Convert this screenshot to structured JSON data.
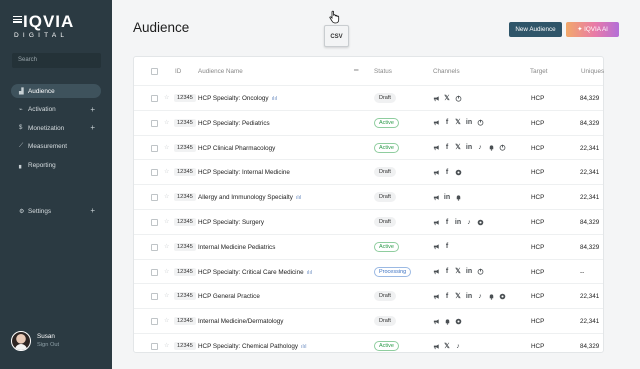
{
  "brand": {
    "name": "IQVIA",
    "sub": "DIGITAL"
  },
  "sidebar": {
    "search_placeholder": "Search",
    "items": [
      {
        "label": "Audience",
        "icon": "audience-icon",
        "active": true,
        "expandable": false
      },
      {
        "label": "Activation",
        "icon": "activation-icon",
        "active": false,
        "expandable": true
      },
      {
        "label": "Monetization",
        "icon": "dollar-icon",
        "active": false,
        "expandable": true
      },
      {
        "label": "Measurement",
        "icon": "trend-icon",
        "active": false,
        "expandable": false
      },
      {
        "label": "Reporting",
        "icon": "bar-chart-icon",
        "active": false,
        "expandable": false
      }
    ],
    "settings": {
      "label": "Settings",
      "icon": "gear-icon"
    },
    "user": {
      "name": "Susan",
      "signout": "Sign Out"
    }
  },
  "header": {
    "title": "Audience",
    "csv_label": "CSV",
    "new_audience_label": "New Audience",
    "ai_label": "IQVIA AI"
  },
  "table": {
    "columns": {
      "id": "ID",
      "name": "Audience Name",
      "status": "Status",
      "channels": "Channels",
      "target": "Target",
      "uniques": "Uniques"
    },
    "rows": [
      {
        "id": "12345",
        "name": "HCP Specialty: Oncology",
        "aud_icon": true,
        "status": "Draft",
        "channels": [
          "ads",
          "x",
          "power"
        ],
        "target": "HCP",
        "uniques": "84,329"
      },
      {
        "id": "12345",
        "name": "HCP Specialty: Pediatrics",
        "aud_icon": false,
        "status": "Active",
        "channels": [
          "ads",
          "facebook",
          "x",
          "linkedin",
          "power"
        ],
        "target": "HCP",
        "uniques": "84,329"
      },
      {
        "id": "12345",
        "name": "HCP Clinical Pharmacology",
        "aud_icon": false,
        "status": "Active",
        "channels": [
          "ads",
          "facebook",
          "x",
          "linkedin",
          "tiktok",
          "bell",
          "power"
        ],
        "target": "HCP",
        "uniques": "22,341"
      },
      {
        "id": "12345",
        "name": "HCP Specialty: Internal Medicine",
        "aud_icon": false,
        "status": "Draft",
        "channels": [
          "ads",
          "facebook",
          "gear"
        ],
        "target": "HCP",
        "uniques": "22,341"
      },
      {
        "id": "12345",
        "name": "Allergy and Immunology Specialty",
        "aud_icon": true,
        "status": "Draft",
        "channels": [
          "ads",
          "linkedin",
          "bell"
        ],
        "target": "HCP",
        "uniques": "22,341"
      },
      {
        "id": "12345",
        "name": "HCP Specialty: Surgery",
        "aud_icon": false,
        "status": "Draft",
        "channels": [
          "ads",
          "facebook",
          "linkedin",
          "tiktok",
          "gear"
        ],
        "target": "HCP",
        "uniques": "84,329"
      },
      {
        "id": "12345",
        "name": "Internal Medicine Pediatrics",
        "aud_icon": false,
        "status": "Active",
        "channels": [
          "ads",
          "facebook"
        ],
        "target": "HCP",
        "uniques": "84,329"
      },
      {
        "id": "12345",
        "name": "HCP Specialty: Critical Care Medicine",
        "aud_icon": true,
        "status": "Processing",
        "channels": [
          "ads",
          "facebook",
          "x",
          "linkedin",
          "power"
        ],
        "target": "HCP",
        "uniques": "--"
      },
      {
        "id": "12345",
        "name": "HCP General Practice",
        "aud_icon": false,
        "status": "Draft",
        "channels": [
          "ads",
          "facebook",
          "x",
          "linkedin",
          "tiktok",
          "bell",
          "gear"
        ],
        "target": "HCP",
        "uniques": "22,341"
      },
      {
        "id": "12345",
        "name": "Internal Medicine/Dermatology",
        "aud_icon": false,
        "status": "Draft",
        "channels": [
          "ads",
          "bell",
          "gear"
        ],
        "target": "HCP",
        "uniques": "22,341"
      },
      {
        "id": "12345",
        "name": "HCP Specialty: Chemical Pathology",
        "aud_icon": true,
        "status": "Active",
        "channels": [
          "ads",
          "x",
          "tiktok"
        ],
        "target": "HCP",
        "uniques": "84,329"
      }
    ]
  }
}
